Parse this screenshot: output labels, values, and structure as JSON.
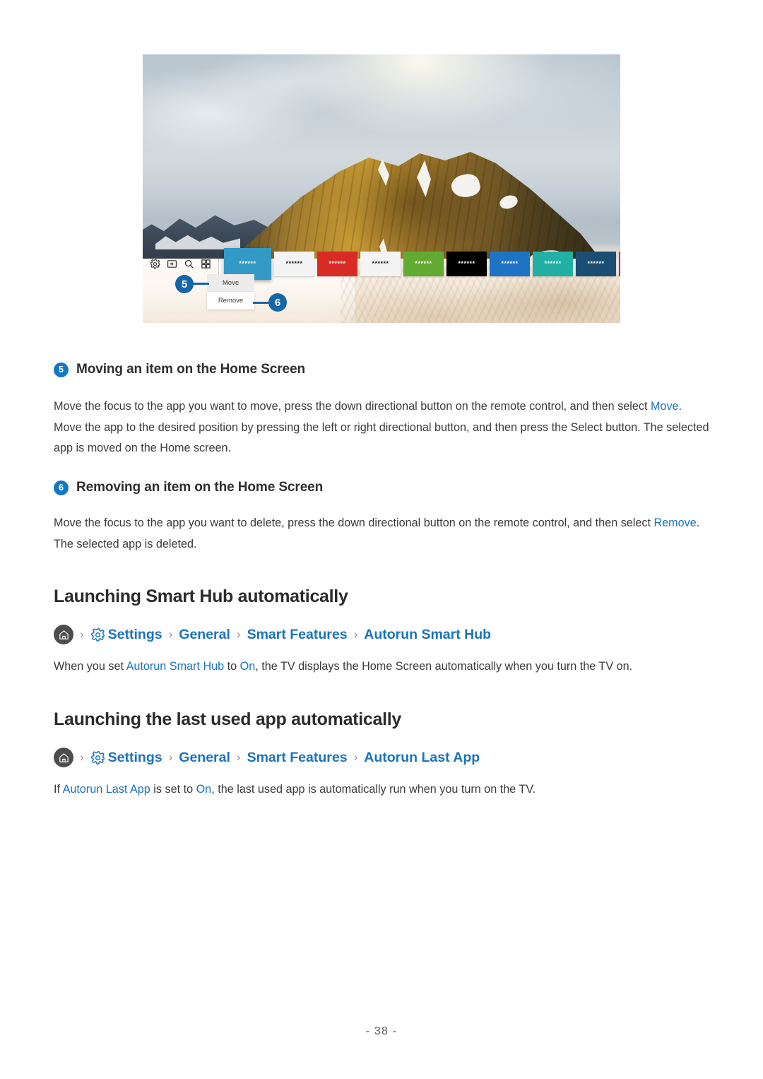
{
  "figure": {
    "name": "smart-hub-home-screen",
    "hub_icons": [
      "gear-icon",
      "source-input-icon",
      "search-icon",
      "apps-grid-icon"
    ],
    "tiles": [
      {
        "label": "******",
        "color": "#3399c5",
        "text_color": "#ffffff",
        "focused": true
      },
      {
        "label": "******",
        "color": "#f4f4f4",
        "text_color": "#1c1c1c",
        "focused": false
      },
      {
        "label": "******",
        "color": "#d92b26",
        "text_color": "#ffffff",
        "focused": false
      },
      {
        "label": "******",
        "color": "#f4f4f4",
        "text_color": "#1c1c1c",
        "focused": false
      },
      {
        "label": "******",
        "color": "#62ab32",
        "text_color": "#ffffff",
        "focused": false
      },
      {
        "label": "******",
        "color": "#000000",
        "text_color": "#ffffff",
        "focused": false
      },
      {
        "label": "******",
        "color": "#1f73c4",
        "text_color": "#ffffff",
        "focused": false
      },
      {
        "label": "******",
        "color": "#22b0a5",
        "text_color": "#ffffff",
        "focused": false
      },
      {
        "label": "******",
        "color": "#1b4e72",
        "text_color": "#ffffff",
        "focused": false
      },
      {
        "label": "*****",
        "color": "#d4128f",
        "text_color": "#ffffff",
        "focused": false
      }
    ],
    "context_menu": {
      "move_label": "Move",
      "remove_label": "Remove"
    },
    "callouts": [
      {
        "number": "5",
        "target": "Move"
      },
      {
        "number": "6",
        "target": "Remove"
      }
    ]
  },
  "sections": {
    "moving": {
      "badge": "5",
      "title": "Moving an item on the Home Screen",
      "body_part1": "Move the focus to the app you want to move, press the down directional button on the remote control, and then select ",
      "body_link": "Move",
      "body_part2": ". Move the app to the desired position by pressing the left or right directional button, and then press the Select button. The selected app is moved on the Home screen."
    },
    "removing": {
      "badge": "6",
      "title": "Removing an item on the Home Screen",
      "body_part1": "Move the focus to the app you want to delete, press the down directional button on the remote control, and then select ",
      "body_link": "Remove",
      "body_part2": ". The selected app is deleted."
    },
    "smart_hub": {
      "heading": "Launching Smart Hub automatically",
      "breadcrumb": {
        "home": "home-icon",
        "gear": "gear-icon",
        "items": [
          "Settings",
          "General",
          "Smart Features",
          "Autorun Smart Hub"
        ],
        "separator": "›"
      },
      "body_part1": "When you set ",
      "body_link1": "Autorun Smart Hub",
      "body_part2": " to ",
      "body_link2": "On",
      "body_part3": ", the TV displays the Home Screen automatically when you turn the TV on."
    },
    "last_app": {
      "heading": "Launching the last used app automatically",
      "breadcrumb": {
        "home": "home-icon",
        "gear": "gear-icon",
        "items": [
          "Settings",
          "General",
          "Smart Features",
          "Autorun Last App"
        ],
        "separator": "›"
      },
      "body_part1": "If ",
      "body_link1": "Autorun Last App",
      "body_part2": " is set to ",
      "body_link2": "On",
      "body_part3": ", the last used app is automatically run when you turn on the TV."
    }
  },
  "footer": {
    "page_number": "- 38 -"
  },
  "colors": {
    "link": "#1a73bd",
    "badge": "#1577c4",
    "callout": "#1565a8",
    "heading": "#2b2b2b",
    "body": "#3a3a3a"
  }
}
